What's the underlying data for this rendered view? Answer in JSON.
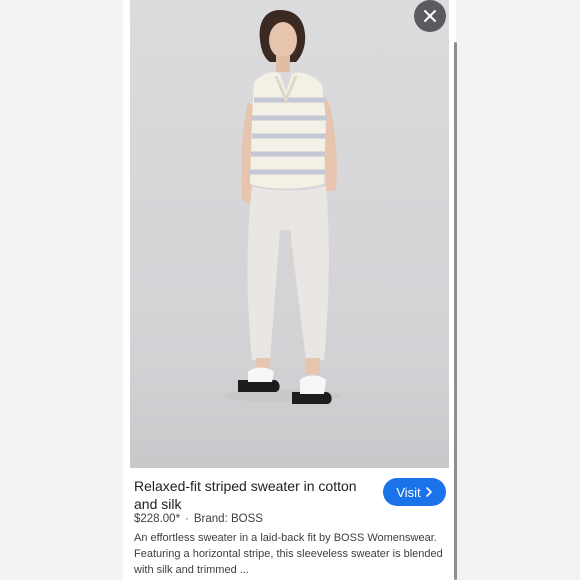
{
  "product": {
    "title": "Relaxed-fit striped sweater in cotton and silk",
    "price": "$228.00*",
    "separator": "·",
    "brand": "Brand: BOSS",
    "description": "An effortless sweater in a laid-back fit by BOSS Womenswear. Featuring a horizontal stripe, this sleeveless sweater is blended with silk and trimmed ..."
  },
  "actions": {
    "visit_label": "Visit",
    "close_icon": "close-icon",
    "visit_icon": "chevron-right-icon"
  },
  "colors": {
    "accent": "#1a73e8",
    "close_button": "#5b5b5f",
    "photo_background": "#d8d8da"
  }
}
